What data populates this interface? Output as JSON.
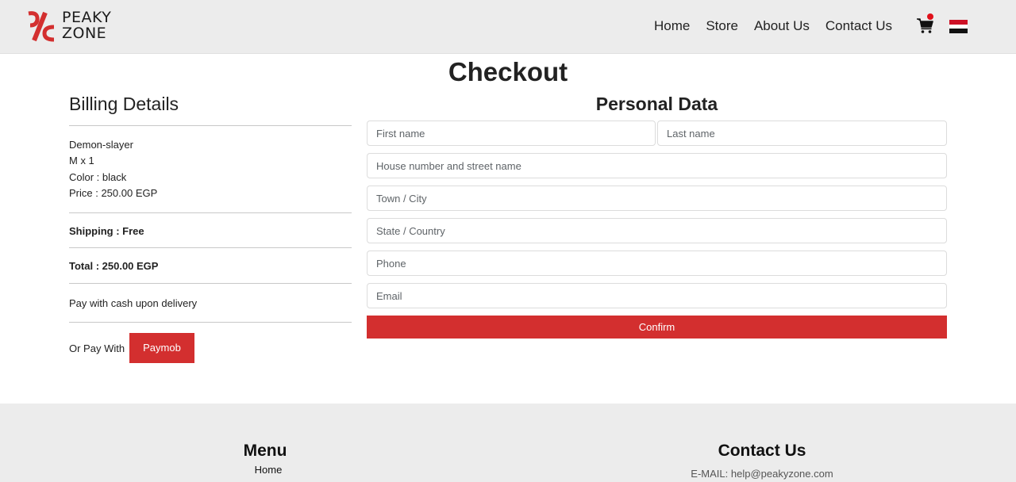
{
  "brand": {
    "name_line1": "PEAKY",
    "name_line2": "ZONE",
    "accent_color": "#d32f2f"
  },
  "nav": {
    "links": [
      "Home",
      "Store",
      "About Us",
      "Contact Us"
    ],
    "cart_icon": "cart-icon",
    "language_icon": "egypt-flag-icon"
  },
  "page": {
    "title": "Checkout"
  },
  "billing": {
    "title": "Billing Details",
    "item_name": "Demon-slayer",
    "item_size_qty": "M x 1",
    "item_color": "Color : black",
    "item_price": "Price : 250.00 EGP",
    "shipping_label": "Shipping : ",
    "shipping_value": "Free",
    "total": "Total : 250.00 EGP",
    "cash_option": "Pay with cash upon delivery",
    "or_pay_with": "Or Pay With",
    "paymob_label": "Paymob"
  },
  "personal": {
    "title": "Personal Data",
    "first_name_placeholder": "First name",
    "last_name_placeholder": "Last name",
    "address_placeholder": "House number and street name",
    "city_placeholder": "Town / City",
    "state_placeholder": "State / Country",
    "phone_placeholder": "Phone",
    "email_placeholder": "Email",
    "confirm_label": "Confirm"
  },
  "footer": {
    "menu_title": "Menu",
    "menu_items": [
      "Home"
    ],
    "contact_title": "Contact Us",
    "email_text": "E-MAIL: help@peakyzone.com"
  }
}
